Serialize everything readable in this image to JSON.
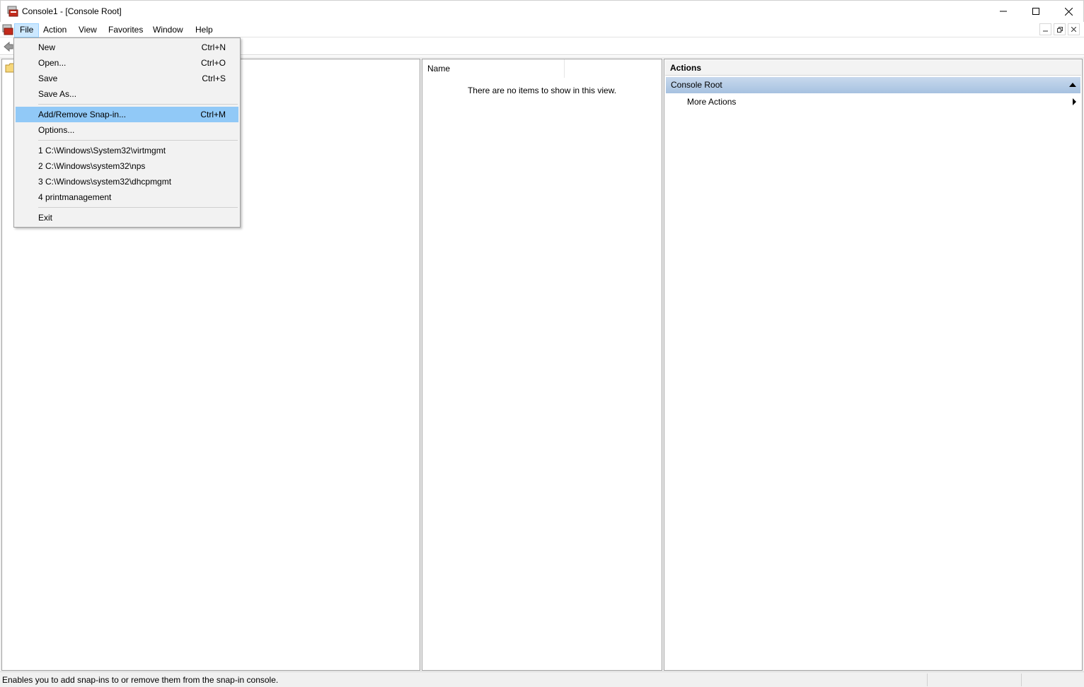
{
  "window": {
    "title": "Console1 - [Console Root]"
  },
  "menubar": {
    "items": [
      "File",
      "Action",
      "View",
      "Favorites",
      "Window",
      "Help"
    ]
  },
  "file_menu": {
    "items": [
      {
        "label": "New",
        "shortcut": "Ctrl+N"
      },
      {
        "label": "Open...",
        "shortcut": "Ctrl+O"
      },
      {
        "label": "Save",
        "shortcut": "Ctrl+S"
      },
      {
        "label": "Save As...",
        "shortcut": ""
      },
      {
        "label": "Add/Remove Snap-in...",
        "shortcut": "Ctrl+M"
      },
      {
        "label": "Options...",
        "shortcut": ""
      },
      {
        "label": "1 C:\\Windows\\System32\\virtmgmt",
        "shortcut": ""
      },
      {
        "label": "2 C:\\Windows\\system32\\nps",
        "shortcut": ""
      },
      {
        "label": "3 C:\\Windows\\system32\\dhcpmgmt",
        "shortcut": ""
      },
      {
        "label": "4 printmanagement",
        "shortcut": ""
      },
      {
        "label": "Exit",
        "shortcut": ""
      }
    ],
    "highlighted": "Add/Remove Snap-in..."
  },
  "list_pane": {
    "column_name": "Name",
    "empty_message": "There are no items to show in this view."
  },
  "actions_pane": {
    "header": "Actions",
    "group": "Console Root",
    "more_actions": "More Actions"
  },
  "statusbar": {
    "text": "Enables you to add snap-ins to or remove them from the snap-in console."
  },
  "colors": {
    "menu_highlight": "#91c9f7",
    "active_menu_bg": "#cce8ff",
    "actions_group_bg": "#b7cde6"
  },
  "icons": [
    "mmc-app-icon",
    "minimize-icon",
    "maximize-icon",
    "close-icon",
    "back-arrow-icon",
    "folder-icon",
    "collapse-arrow-icon",
    "submenu-arrow-icon"
  ]
}
